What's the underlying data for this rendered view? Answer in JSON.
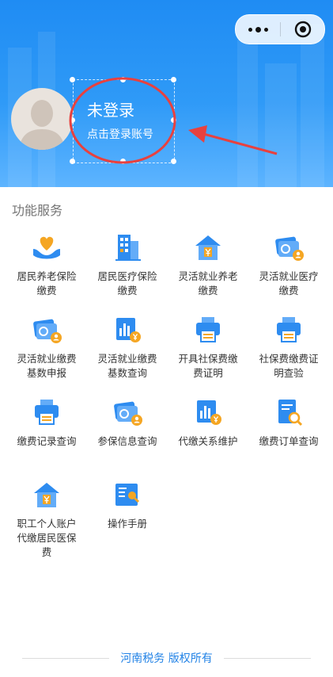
{
  "header": {
    "login_title": "未登录",
    "login_subtitle": "点击登录账号"
  },
  "section": {
    "title": "功能服务"
  },
  "services": [
    {
      "label": "居民养老保险\n缴费",
      "icon": "heart-hand-icon"
    },
    {
      "label": "居民医疗保险\n缴费",
      "icon": "building-icon"
    },
    {
      "label": "灵活就业养老\n缴费",
      "icon": "house-yen-icon"
    },
    {
      "label": "灵活就业医疗\n缴费",
      "icon": "card-user-icon"
    },
    {
      "label": "灵活就业缴费\n基数申报",
      "icon": "card-user-icon"
    },
    {
      "label": "灵活就业缴费\n基数查询",
      "icon": "chart-yen-icon"
    },
    {
      "label": "开具社保费缴\n费证明",
      "icon": "printer-icon"
    },
    {
      "label": "社保费缴费证\n明查验",
      "icon": "printer-icon"
    },
    {
      "label": "缴费记录查询",
      "icon": "printer-icon"
    },
    {
      "label": "参保信息查询",
      "icon": "card-user-icon"
    },
    {
      "label": "代缴关系维护",
      "icon": "chart-yen-icon"
    },
    {
      "label": "缴费订单查询",
      "icon": "doc-search-icon"
    },
    {
      "label": "职工个人账户\n代缴居民医保\n费",
      "icon": "house-yen-icon"
    },
    {
      "label": "操作手册",
      "icon": "book-search-icon"
    }
  ],
  "footer": {
    "copyright": "河南税务 版权所有"
  },
  "colors": {
    "primary": "#1f8cf3",
    "accent": "#f5a623",
    "icon_blue": "#2e8cf0"
  }
}
